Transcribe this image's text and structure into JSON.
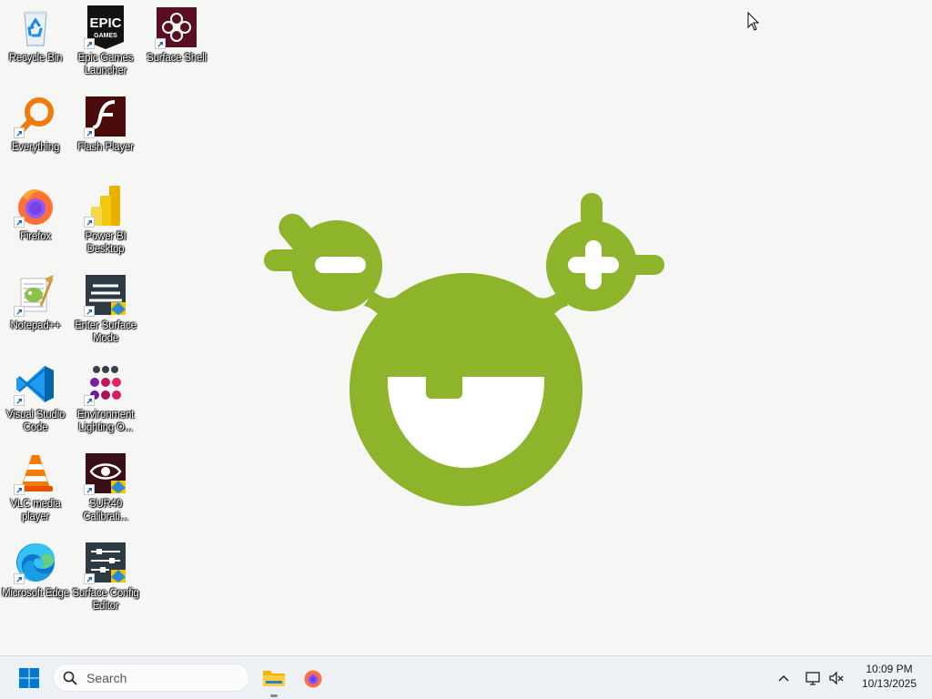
{
  "desktop": {
    "icons": [
      {
        "id": "recycle-bin",
        "label": "Recycle Bin",
        "shortcut": false
      },
      {
        "id": "epic-games-launcher",
        "label": "Epic Games Launcher",
        "shortcut": true
      },
      {
        "id": "surface-shell",
        "label": "Surface Shell",
        "shortcut": true
      },
      {
        "id": "everything",
        "label": "Everything",
        "shortcut": true
      },
      {
        "id": "flash-player",
        "label": "Flash Player",
        "shortcut": true
      },
      {
        "id": "firefox",
        "label": "Firefox",
        "shortcut": true
      },
      {
        "id": "power-bi-desktop",
        "label": "Power BI Desktop",
        "shortcut": true
      },
      {
        "id": "notepad-plus-plus",
        "label": "Notepad++",
        "shortcut": true
      },
      {
        "id": "enter-surface-mode",
        "label": "Enter Surface Mode",
        "shortcut": true
      },
      {
        "id": "visual-studio-code",
        "label": "Visual Studio Code",
        "shortcut": true
      },
      {
        "id": "environment-lighting",
        "label": "Environment Lighting O...",
        "shortcut": true
      },
      {
        "id": "vlc-media-player",
        "label": "VLC media player",
        "shortcut": true
      },
      {
        "id": "sur40-calibration",
        "label": "SUR40 Calibrati...",
        "shortcut": true
      },
      {
        "id": "microsoft-edge",
        "label": "Microsoft Edge",
        "shortcut": true
      },
      {
        "id": "surface-config-editor",
        "label": "Surface Config Editor",
        "shortcut": true
      }
    ],
    "wallpaper_color": "#8db42a",
    "epic_logo_top": "EPIC",
    "epic_logo_bottom": "GAMES"
  },
  "taskbar": {
    "search_placeholder": "Search",
    "pinned": [
      {
        "id": "file-explorer",
        "icon": "folder-icon",
        "active": true
      },
      {
        "id": "firefox",
        "icon": "firefox-icon",
        "active": false
      }
    ],
    "clock_time": "10:09 PM",
    "clock_date": "10/13/2025"
  },
  "colors": {
    "taskbar_bg": "#eef1f5",
    "desktop_bg": "#f6f6f5",
    "accent_blue": "#0078d4"
  }
}
